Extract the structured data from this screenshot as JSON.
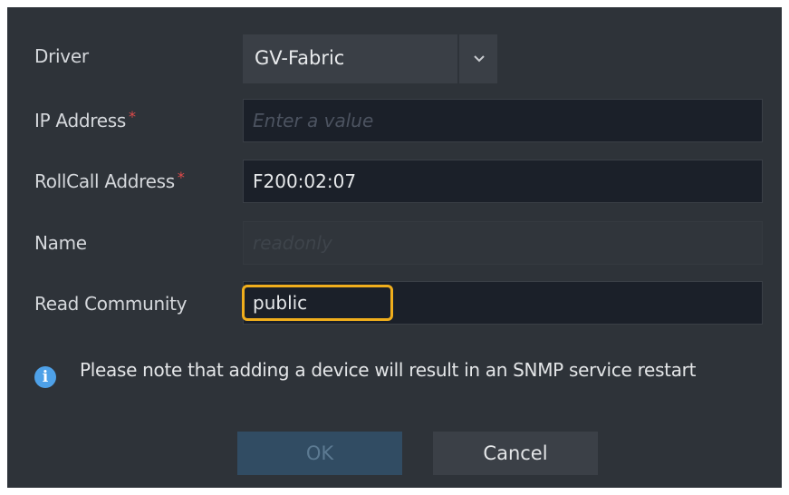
{
  "form": {
    "driver": {
      "label": "Driver",
      "value": "GV-Fabric"
    },
    "ip_address": {
      "label": "IP Address",
      "required": "*",
      "value": "",
      "placeholder": "Enter a value"
    },
    "rollcall_address": {
      "label": "RollCall Address",
      "required": "*",
      "value": "F200:02:07"
    },
    "name": {
      "label": "Name",
      "placeholder": "readonly"
    },
    "read_community": {
      "label": "Read Community",
      "value": "public"
    }
  },
  "note": {
    "icon": "info-icon",
    "text": "Please note that adding a device will result in an SNMP service restart"
  },
  "buttons": {
    "ok": "OK",
    "cancel": "Cancel"
  },
  "colors": {
    "dialog_bg": "#2e3339",
    "input_bg": "#1b2029",
    "required": "#e24a4a",
    "focus": "#f0ae1c",
    "info": "#4ea1e8",
    "ok_disabled": "#314c63"
  }
}
